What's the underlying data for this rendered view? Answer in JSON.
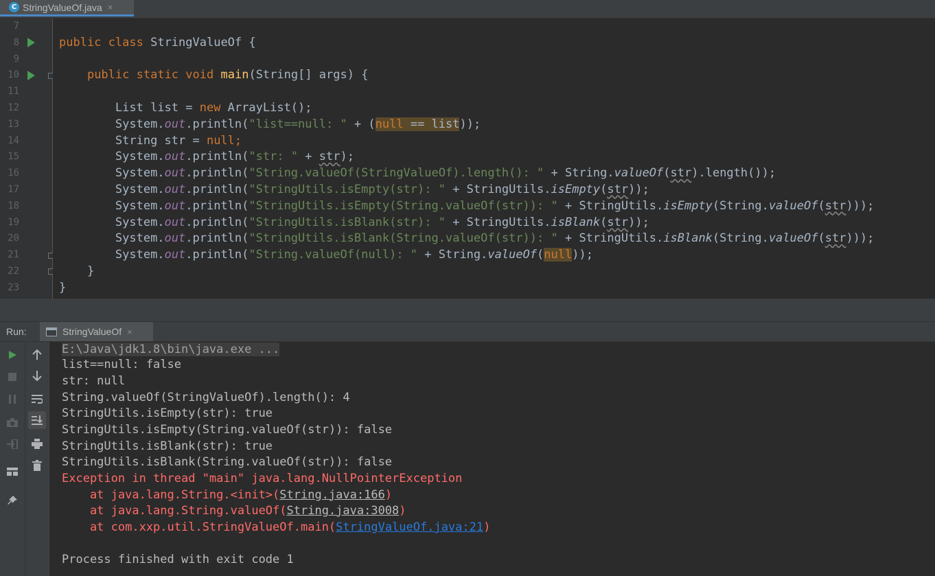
{
  "tab": {
    "filename": "StringValueOf.java",
    "close": "×",
    "type_letter": "C"
  },
  "gutter": {
    "lines": [
      "7",
      "8",
      "9",
      "10",
      "11",
      "12",
      "13",
      "14",
      "15",
      "16",
      "17",
      "18",
      "19",
      "20",
      "21",
      "22",
      "23"
    ]
  },
  "code": {
    "l8": [
      "public",
      " ",
      "class",
      " StringValueOf {"
    ],
    "l10": [
      "public",
      " ",
      "static",
      " ",
      "void",
      " ",
      "main",
      "(String[] args) {"
    ],
    "l12": [
      "List list = ",
      "new",
      " ArrayList();"
    ],
    "l13": [
      "System.",
      "out",
      ".println(",
      "\"list==null: \"",
      " + (",
      "null == list",
      "));"
    ],
    "l14": [
      "String str = ",
      "null",
      ";"
    ],
    "l15": [
      "System.",
      "out",
      ".println(",
      "\"str: \"",
      " + ",
      "str",
      ");"
    ],
    "l16": [
      "System.",
      "out",
      ".println(",
      "\"String.valueOf(StringValueOf).length(): \"",
      " + String.",
      "valueOf",
      "(",
      "str",
      ").length());"
    ],
    "l17": [
      "System.",
      "out",
      ".println(",
      "\"StringUtils.isEmpty(str): \"",
      " + StringUtils.",
      "isEmpty",
      "(",
      "str",
      "));"
    ],
    "l18": [
      "System.",
      "out",
      ".println(",
      "\"StringUtils.isEmpty(String.valueOf(str)): \"",
      " + StringUtils.",
      "isEmpty",
      "(String.",
      "valueOf",
      "(",
      "str",
      ")));"
    ],
    "l19": [
      "System.",
      "out",
      ".println(",
      "\"StringUtils.isBlank(str): \"",
      " + StringUtils.",
      "isBlank",
      "(",
      "str",
      "));"
    ],
    "l20": [
      "System.",
      "out",
      ".println(",
      "\"StringUtils.isBlank(String.valueOf(str)): \"",
      " + StringUtils.",
      "isBlank",
      "(String.",
      "valueOf",
      "(",
      "str",
      ")));"
    ],
    "l21": [
      "System.",
      "out",
      ".println(",
      "\"String.valueOf(null): \"",
      " + String.",
      "valueOf",
      "(",
      "null",
      "));"
    ],
    "l22": "}",
    "l23": "}"
  },
  "run": {
    "label": "Run:",
    "tab": "StringValueOf",
    "close": "×"
  },
  "console": {
    "cmd": "E:\\Java\\jdk1.8\\bin\\java.exe ...",
    "out": [
      "list==null: false",
      "str: null",
      "String.valueOf(StringValueOf).length(): 4",
      "StringUtils.isEmpty(str): true",
      "StringUtils.isEmpty(String.valueOf(str)): false",
      "StringUtils.isBlank(str): true",
      "StringUtils.isBlank(String.valueOf(str)): false"
    ],
    "exception": "Exception in thread \"main\" java.lang.NullPointerException",
    "stack": [
      {
        "prefix": "    at java.lang.String.<init>(",
        "link": "String.java:166",
        "suffix": ")"
      },
      {
        "prefix": "    at java.lang.String.valueOf(",
        "link": "String.java:3008",
        "suffix": ")"
      },
      {
        "prefix": "    at com.xxp.util.StringValueOf.main(",
        "link": "StringValueOf.java:21",
        "suffix": ")"
      }
    ],
    "exit": "Process finished with exit code 1"
  },
  "colors": {
    "keyword": "#cc7832",
    "string": "#6a8759",
    "method": "#ffc66d",
    "field": "#9876aa",
    "error": "#ff6b68",
    "link": "#287bde"
  },
  "icons": {
    "left1": [
      "run-icon",
      "stop-icon",
      "pause-icon",
      "camera-icon",
      "login-icon",
      "layout-icon",
      "pin-icon"
    ],
    "left2": [
      "arrow-up-icon",
      "arrow-down-icon",
      "soft-wrap-icon",
      "scroll-to-end-icon",
      "print-icon",
      "trash-icon"
    ]
  }
}
